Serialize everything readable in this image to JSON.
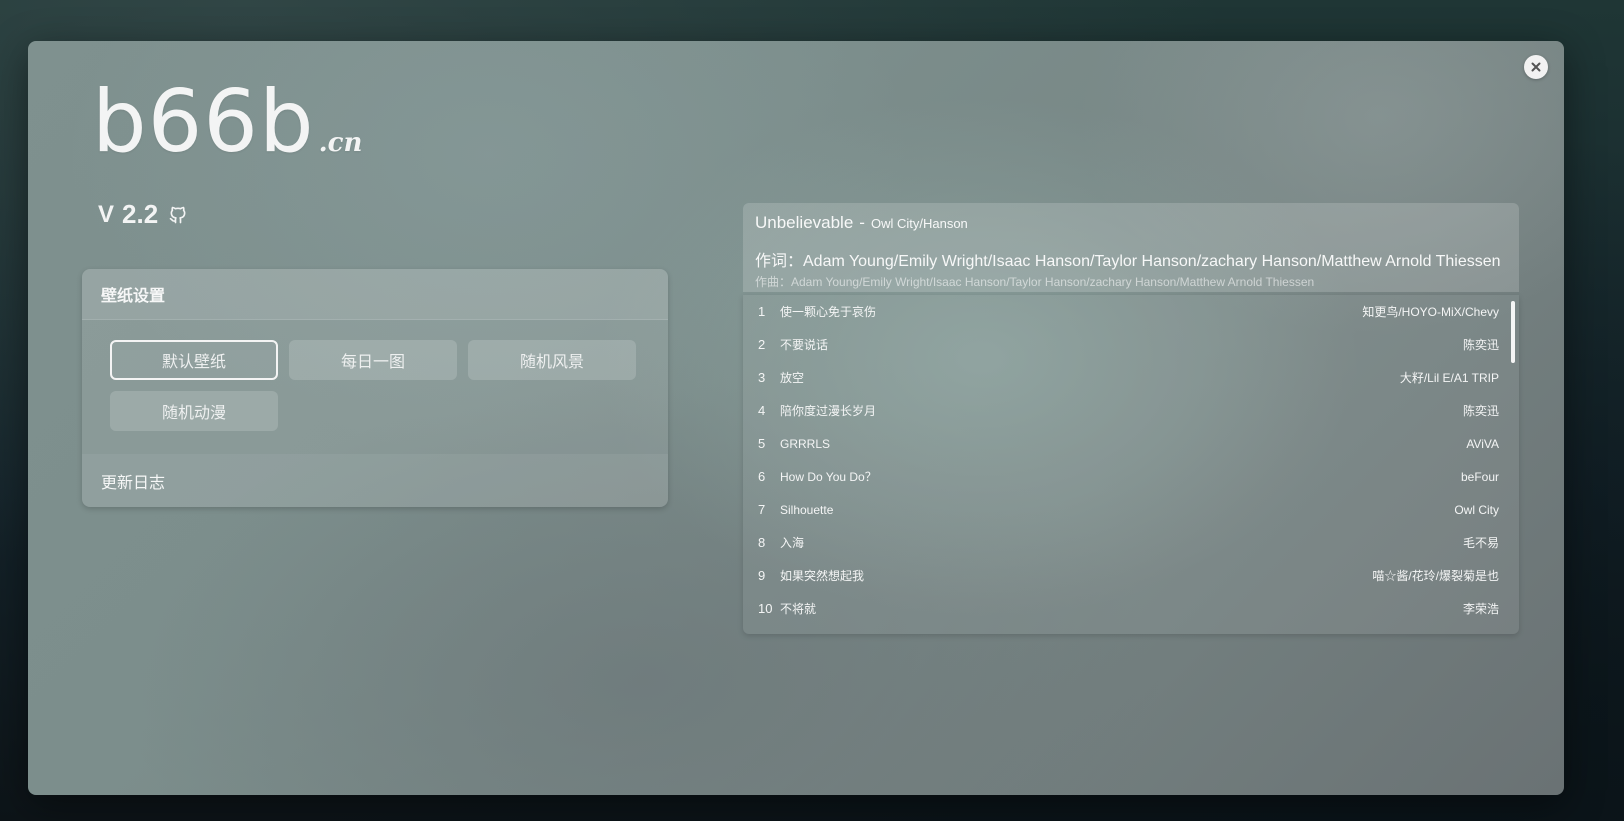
{
  "logo": {
    "main": "b66b",
    "suffix": ".cn"
  },
  "version": {
    "prefix": "V",
    "number": "2.2",
    "github_icon": "github-icon"
  },
  "settings": {
    "title": "壁纸设置",
    "buttons": [
      "默认壁纸",
      "每日一图",
      "随机风景",
      "随机动漫"
    ],
    "active_index": 0,
    "changelog": "更新日志"
  },
  "now_playing": {
    "title": "Unbelievable",
    "separator": "-",
    "artist": "Owl City/Hanson",
    "lyric_line_1": "作词：Adam Young/Emily Wright/Isaac Hanson/Taylor Hanson/zachary Hanson/Matthew Arnold Thiessen",
    "lyric_line_2": "作曲：Adam Young/Emily Wright/Isaac Hanson/Taylor Hanson/zachary Hanson/Matthew Arnold Thiessen"
  },
  "playlist": [
    {
      "num": "1",
      "name": "使一颗心免于哀伤",
      "artist": "知更鸟/HOYO-MiX/Chevy"
    },
    {
      "num": "2",
      "name": "不要说话",
      "artist": "陈奕迅"
    },
    {
      "num": "3",
      "name": "放空",
      "artist": "大籽/Lil E/A1 TRIP"
    },
    {
      "num": "4",
      "name": "陪你度过漫长岁月",
      "artist": "陈奕迅"
    },
    {
      "num": "5",
      "name": "GRRRLS",
      "artist": "AViVA"
    },
    {
      "num": "6",
      "name": "How Do You Do？",
      "artist": "beFour"
    },
    {
      "num": "7",
      "name": "Silhouette",
      "artist": "Owl City"
    },
    {
      "num": "8",
      "name": "入海",
      "artist": "毛不易"
    },
    {
      "num": "9",
      "name": "如果突然想起我",
      "artist": "喵☆酱/花玲/爆裂菊是也"
    },
    {
      "num": "10",
      "name": "不将就",
      "artist": "李荣浩"
    }
  ],
  "colors": {
    "text": "#f3f4f4",
    "close_bg": "#f2f2f2",
    "close_fg": "#666666"
  }
}
